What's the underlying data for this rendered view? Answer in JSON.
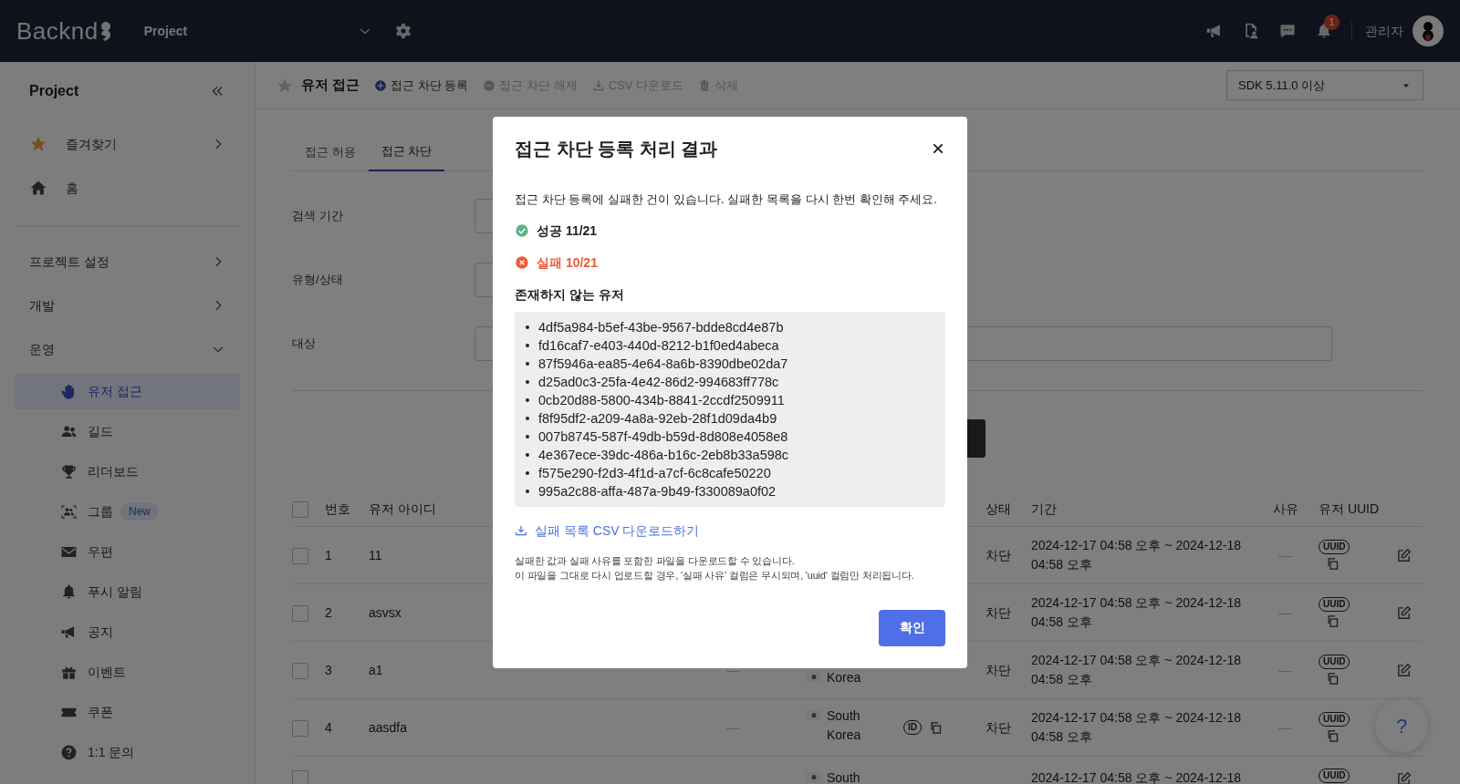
{
  "header": {
    "logo": "Backnd",
    "project": "Project",
    "notification_count": "1",
    "user": "관리자"
  },
  "sidebar": {
    "title": "Project",
    "groups": [
      {
        "items": [
          {
            "label": "즐겨찾기",
            "expanded": false
          },
          {
            "label": "홈"
          }
        ]
      },
      {
        "items": [
          {
            "label": "프로젝트 설정",
            "expanded": false
          },
          {
            "label": "개발",
            "expanded": false
          },
          {
            "label": "운영",
            "expanded": true,
            "children": [
              {
                "label": "유저 접근",
                "selected": true
              },
              {
                "label": "길드",
                "selected": false
              },
              {
                "label": "리더보드",
                "selected": false
              },
              {
                "label": "그룹",
                "selected": false,
                "badge": "New"
              },
              {
                "label": "우편",
                "selected": false
              },
              {
                "label": "푸시 알림",
                "selected": false
              },
              {
                "label": "공지",
                "selected": false
              },
              {
                "label": "이벤트",
                "selected": false
              },
              {
                "label": "쿠폰",
                "selected": false
              },
              {
                "label": "1:1 문의",
                "selected": false
              }
            ]
          }
        ]
      }
    ]
  },
  "toolbar": {
    "title": "유저 접근",
    "favorite": false,
    "actions": [
      {
        "label": "접근 차단 등록",
        "disabled": false
      },
      {
        "label": "접근 차단 해제",
        "disabled": true
      },
      {
        "label": "CSV 다운로드",
        "disabled": true
      },
      {
        "label": "삭제",
        "disabled": true
      }
    ],
    "sdk_select": "SDK 5.11.0 이상"
  },
  "tabs": [
    {
      "label": "접근 허용",
      "selected": false
    },
    {
      "label": "접근 차단",
      "selected": true
    }
  ],
  "filters": [
    {
      "label": "검색 기간",
      "kind": "field"
    },
    {
      "label": "유형/상태",
      "kind": "select"
    },
    {
      "label": "대상",
      "kind": "wide"
    }
  ],
  "table": {
    "all_checked": false,
    "headers": {
      "number": "번호",
      "user_id": "유저 아이디",
      "state": "상태",
      "period": "기간",
      "reason": "사유",
      "uuid": "유저 UUID"
    },
    "rows": [
      {
        "checked": false,
        "number": "1",
        "user_id": "11",
        "state": "차단",
        "period": "2024-12-17 04:58 오후 ~ 2024-12-18 04:58 오후",
        "reason": "—",
        "uuid_badge": "UUID"
      },
      {
        "checked": false,
        "number": "2",
        "user_id": "asvsx",
        "state": "차단",
        "period": "2024-12-17 04:58 오후 ~ 2024-12-18 04:58 오후",
        "reason": "—",
        "uuid_badge": "UUID"
      },
      {
        "checked": false,
        "number": "3",
        "user_id": "a1",
        "column_4": "—",
        "country": "Korea",
        "state": "차단",
        "period": "2024-12-17 04:58 오후 ~ 2024-12-18 04:58 오후",
        "reason": "—",
        "uuid_badge": "UUID"
      },
      {
        "checked": false,
        "number": "4",
        "user_id": "aasdfa",
        "column_4": "—",
        "country": "South Korea",
        "id_badge": "ID",
        "state": "차단",
        "period": "2024-12-17 04:58 오후 ~ 2024-12-18 04:58 오후",
        "reason": "—",
        "uuid_badge": "UUID"
      },
      {
        "checked": false,
        "country": "South",
        "period": "2024-12-17 04:58 오후 ~ 2024-12-18",
        "uuid_badge": "UUID"
      }
    ]
  },
  "help": "?",
  "modal": {
    "title": "접근 차단 등록 처리 결과",
    "message": "접근 차단 등록에 실패한 건이 있습니다. 실패한 목록을 다시 한번 확인해 주세요.",
    "results": [
      {
        "kind": "success",
        "label": "성공 11/21"
      },
      {
        "kind": "failure",
        "label": "실패 10/21"
      }
    ],
    "section_title": "존재하지 않는 유저",
    "failed_ids": [
      "4df5a984-b5ef-43be-9567-bdde8cd4e87b",
      "fd16caf7-e403-440d-8212-b1f0ed4abeca",
      "87f5946a-ea85-4e64-8a6b-8390dbe02da7",
      "d25ad0c3-25fa-4e42-86d2-994683ff778c",
      "0cb20d88-5800-434b-8841-2ccdf2509911",
      "f8f95df2-a209-4a8a-92eb-28f1d09da4b9",
      "007b8745-587f-49db-b59d-8d808e4058e8",
      "4e367ece-39dc-486a-b16c-2eb8b33a598c",
      "f575e290-f2d3-4f1d-a7cf-6c8cafe50220",
      "995a2c88-affa-487a-9b49-f330089a0f02"
    ],
    "download_link": "실패 목록 CSV 다운로드하기",
    "notes": [
      "실패한 값과 실패 사유를 포함한 파일을 다운로드할 수 있습니다.",
      "이 파일을 그대로 다시 업로드할 경우, '실패 사유' 컬럼은 무시되며, 'uuid' 컬럼만 처리됩니다."
    ],
    "confirm": "확인"
  }
}
